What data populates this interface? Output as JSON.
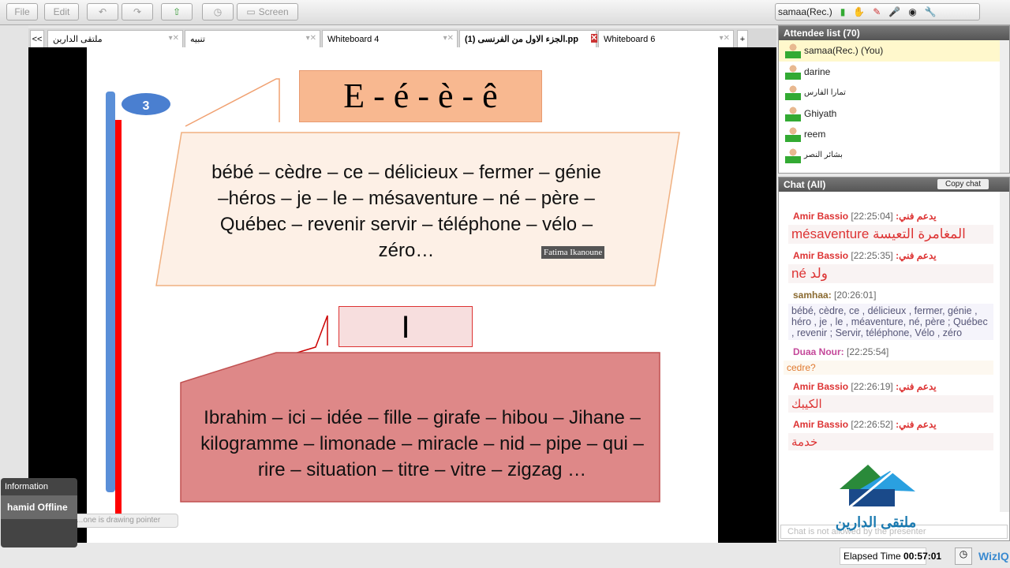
{
  "toolbar": {
    "file": "File",
    "edit": "Edit",
    "screen": "Screen",
    "user": "samaa(Rec.)"
  },
  "tabs": [
    {
      "label": "ملتقى الدارين"
    },
    {
      "label": "تنبيه"
    },
    {
      "label": "Whiteboard 4"
    },
    {
      "label": "الجزء الاول من الفرنسى (1).pp"
    },
    {
      "label": "Whiteboard 6"
    }
  ],
  "tabs_toggle": "<<",
  "tabs_add": "+",
  "slide": {
    "badge": "3",
    "title1": "E  - é - è - ê",
    "para1": "bébé – cèdre – ce – délicieux – fermer – génie –héros – je – le – mésaventure – né – père – Québec – revenir servir – téléphone – vélo – zéro…",
    "pointer_label": "Fatima Ikanoune",
    "title2": "I",
    "para2": "Ibrahim – ici – idée – fille – girafe – hibou – Jihane – kilogramme – limonade – miracle – nid – pipe – qui – rire – situation – titre – vitre – zigzag …"
  },
  "info": {
    "title": "Information",
    "text": "hamid Offline",
    "status": "...one is drawing pointer"
  },
  "attendees": {
    "title": "Attendee list (70)",
    "list": [
      "samaa(Rec.) (You)",
      "darine",
      "تمارا الفارس",
      "Ghiyath",
      "reem",
      "بشائر النصر"
    ]
  },
  "chat": {
    "title": "Chat (All)",
    "copy": "Copy chat",
    "disabled": "Chat is not allowed by the presenter",
    "messages": [
      {
        "name": "Amir Bassio يدعم فني:",
        "time": "[22:25:04]",
        "text": "mésaventure المغامرة التعيسة"
      },
      {
        "name": "Amir Bassio يدعم فني:",
        "time": "[22:25:35]",
        "text": "né  ولد"
      },
      {
        "name": "samhaa:",
        "time": "[20:26:01]",
        "text": "bébé, cèdre, ce , délicieux , fermer, génie , héro , je , le , méaventure, né, père ; Québec , revenir ; Servir, téléphone, Vélo , zéro"
      },
      {
        "name": "Duaa Nour:",
        "time": "[22:25:54]",
        "text": "cedre?"
      },
      {
        "name": "Amir Bassio يدعم فني:",
        "time": "[22:26:19]",
        "text": "الكيبك"
      },
      {
        "name": "Amir Bassio يدعم فني:",
        "time": "[22:26:52]",
        "text": "خدمة"
      }
    ]
  },
  "footer": {
    "elapsed_label": "Elapsed Time",
    "elapsed": "00:57:01",
    "brand": "WizIQ"
  },
  "watermark": "ملتقى الدارين"
}
